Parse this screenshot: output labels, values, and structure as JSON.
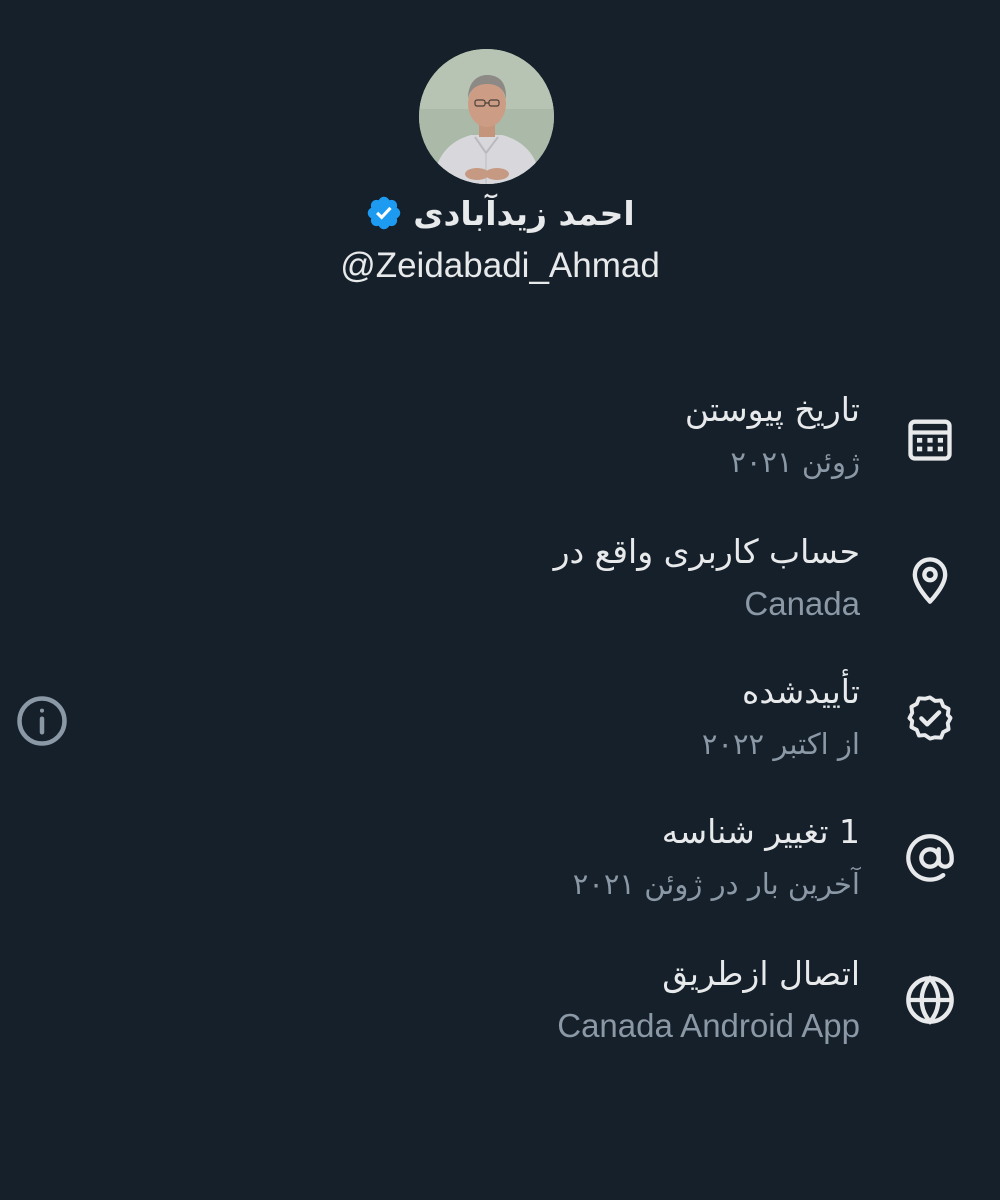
{
  "profile": {
    "display_name": "احمد زیدآبادی",
    "handle": "@Zeidabadi_Ahmad",
    "verified": true,
    "badge_color": "#1d9bf0"
  },
  "about": [
    {
      "icon": "calendar-icon",
      "title": "تاریخ پیوستن",
      "subtitle": "ژوئن ۲۰۲۱"
    },
    {
      "icon": "location-pin-icon",
      "title": "حساب کاربری واقع در",
      "subtitle": "Canada"
    },
    {
      "icon": "verified-badge-icon",
      "title": "تأییدشده",
      "subtitle": "از اکتبر ۲۰۲۲"
    },
    {
      "icon": "at-sign-icon",
      "title": "1 تغییر شناسه",
      "subtitle": "آخرین بار در ژوئن ۲۰۲۱"
    },
    {
      "icon": "globe-icon",
      "title": "اتصال ازطریق",
      "subtitle": "Canada Android App"
    }
  ],
  "colors": {
    "background": "#15202b",
    "primary_text": "#e7e9ea",
    "secondary_text": "#8b98a5",
    "accent": "#1d9bf0"
  }
}
